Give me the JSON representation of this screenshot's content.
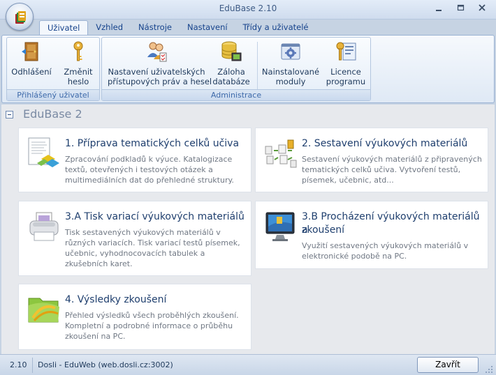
{
  "window": {
    "title": "EduBase 2.10"
  },
  "tabs": [
    {
      "label": "Uživatel",
      "active": true
    },
    {
      "label": "Vzhled"
    },
    {
      "label": "Nástroje"
    },
    {
      "label": "Nastavení"
    },
    {
      "label": "Třídy a uživatelé"
    }
  ],
  "ribbon": {
    "groups": [
      {
        "label": "Přihlášený uživatel",
        "buttons": [
          {
            "line1": "Odhlášení",
            "line2": "",
            "icon": "door-logout-icon"
          },
          {
            "line1": "Změnit",
            "line2": "heslo",
            "icon": "key-icon"
          }
        ]
      },
      {
        "label": "Administrace",
        "buttons": [
          {
            "line1": "Nastavení uživatelských",
            "line2": "přístupových práv a hesel",
            "icon": "users-permissions-icon"
          },
          {
            "line1": "Záloha",
            "line2": "databáze",
            "icon": "database-backup-icon"
          },
          {
            "line1": "Nainstalované",
            "line2": "moduly",
            "icon": "modules-gear-icon"
          },
          {
            "line1": "Licence",
            "line2": "programu",
            "icon": "license-key-icon"
          }
        ]
      }
    ]
  },
  "section": {
    "title": "EduBase 2"
  },
  "cards": [
    {
      "title_lines": [
        "1. Příprava tematických celků učiva"
      ],
      "desc_lines": [
        "Zpracování podkladů k výuce. Katalogizace",
        "textů, otevřených i testových otázek a",
        "multimediálních dat do přehledné struktury."
      ],
      "icon": "documents-preparation-icon"
    },
    {
      "title_lines": [
        "2. Sestavení výukových materiálů"
      ],
      "desc_lines": [
        "Sestavení výukových materiálů z připravených",
        "tematických celků učiva. Vytvoření testů,",
        "písemek, učebnic, atd..."
      ],
      "icon": "assembly-icon"
    },
    {
      "title_lines": [
        "3.A Tisk variací výukových materiálů"
      ],
      "desc_lines": [
        "Tisk sestavených výukových materiálů v",
        "různých variacích.  Tisk variací testů písemek,",
        "učebnic, vyhodnocovacích tabulek a",
        "zkušebních karet."
      ],
      "icon": "printer-icon"
    },
    {
      "title_lines": [
        "3.B Procházení výukových materiálů a",
        "zkoušení"
      ],
      "desc_lines": [
        "Využití sestavených výukových materiálů v",
        "elektronické podobě na PC."
      ],
      "icon": "computer-monitor-icon"
    },
    {
      "title_lines": [
        "4. Výsledky zkoušení"
      ],
      "desc_lines": [
        "Přehled výsledků všech proběhlých zkoušení.",
        "Kompletní a podrobné informace o průběhu",
        "zkoušení na PC."
      ],
      "icon": "results-folder-icon"
    }
  ],
  "status": {
    "version": "2.10",
    "connection": "Dosli - EduWeb (web.dosli.cz:3002)",
    "close_label": "Zavřít"
  }
}
